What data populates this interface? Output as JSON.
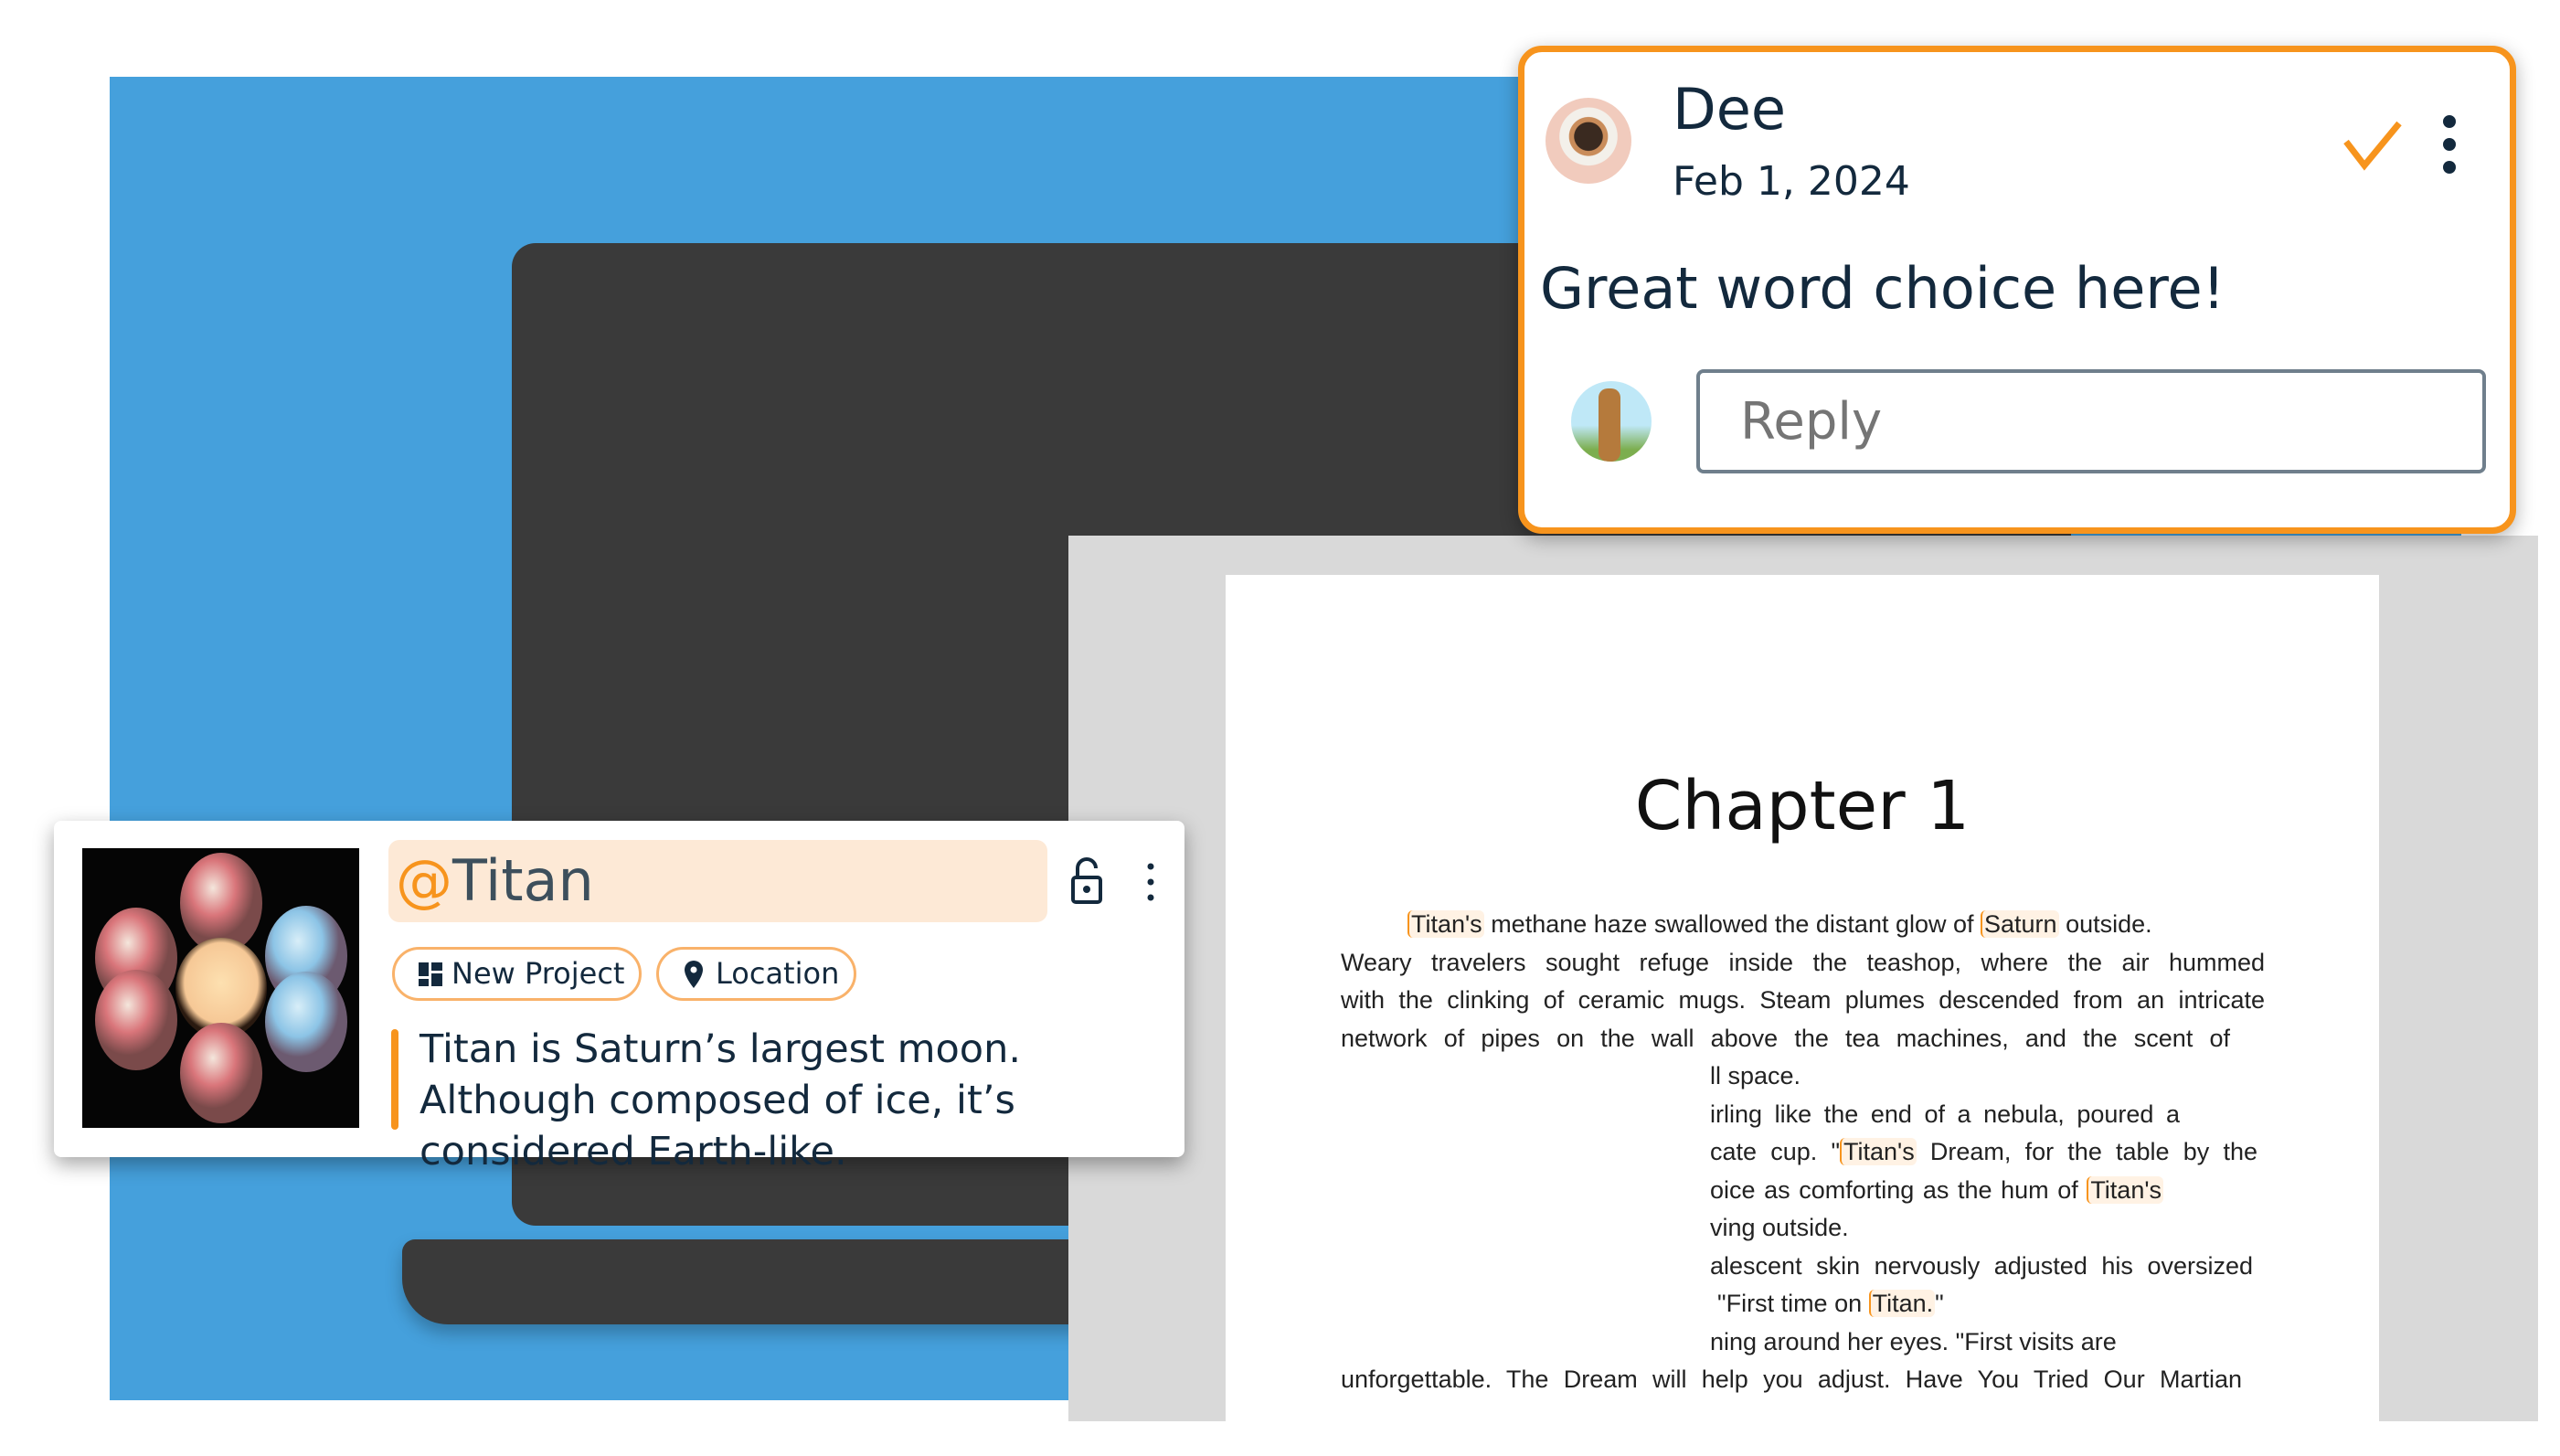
{
  "document": {
    "title": "Chapter 1",
    "lines": [
      {
        "segments": [
          {
            "t": "Titan's",
            "hl": true
          },
          {
            "t": " methane haze swallowed the distant glow of "
          },
          {
            "t": "Saturn",
            "hl": true
          },
          {
            "t": " outside."
          }
        ]
      },
      {
        "segments": [
          {
            "t": "Weary travelers sought refuge inside the teashop, where the air hummed"
          }
        ]
      },
      {
        "segments": [
          {
            "t": "with the clinking of ceramic mugs. Steam plumes descended from an intricate"
          }
        ]
      },
      {
        "segments": [
          {
            "t": "network of pipes on the wall above the tea machines, and the scent of"
          }
        ]
      },
      {
        "segments": [
          {
            "t": "ll space."
          }
        ]
      },
      {
        "segments": [
          {
            "t": "irling like the end of a nebula, poured a"
          }
        ]
      },
      {
        "segments": [
          {
            "t": "cate cup. \""
          },
          {
            "t": "Titan's",
            "hl": true
          },
          {
            "t": " Dream, for the table by the"
          }
        ]
      },
      {
        "segments": [
          {
            "t": "oice as comforting as the hum of "
          },
          {
            "t": "Titan's",
            "hl": true
          }
        ]
      },
      {
        "segments": [
          {
            "t": "ving outside."
          }
        ]
      },
      {
        "segments": [
          {
            "t": "alescent skin nervously adjusted his oversized"
          }
        ]
      },
      {
        "segments": [
          {
            "t": "\"First time on "
          },
          {
            "t": "Titan.",
            "hl": true
          },
          {
            "t": "\""
          }
        ]
      },
      {
        "segments": [
          {
            "t": "ning around her eyes. \"First visits are"
          }
        ]
      },
      {
        "segments": [
          {
            "t": "unforgettable. The Dream will help you adjust. Have You Tried Our Martian"
          }
        ]
      }
    ]
  },
  "comment": {
    "author": "Dee",
    "date": "Feb 1, 2024",
    "text": "Great word choice here!",
    "reply_placeholder": "Reply",
    "resolve_icon": "check-icon",
    "menu_icon": "more-vertical-icon",
    "border_color": "#f7941d"
  },
  "entity_card": {
    "at": "@",
    "name": "Titan",
    "tags": [
      {
        "label": "New Project",
        "icon": "grid-icon"
      },
      {
        "label": "Location",
        "icon": "map-pin-icon"
      }
    ],
    "description": "Titan is Saturn’s largest moon. Although composed of ice, it’s considered Earth-like.",
    "lock_icon": "unlock-icon",
    "menu_icon": "more-vertical-icon",
    "accent": "#f7941d"
  }
}
